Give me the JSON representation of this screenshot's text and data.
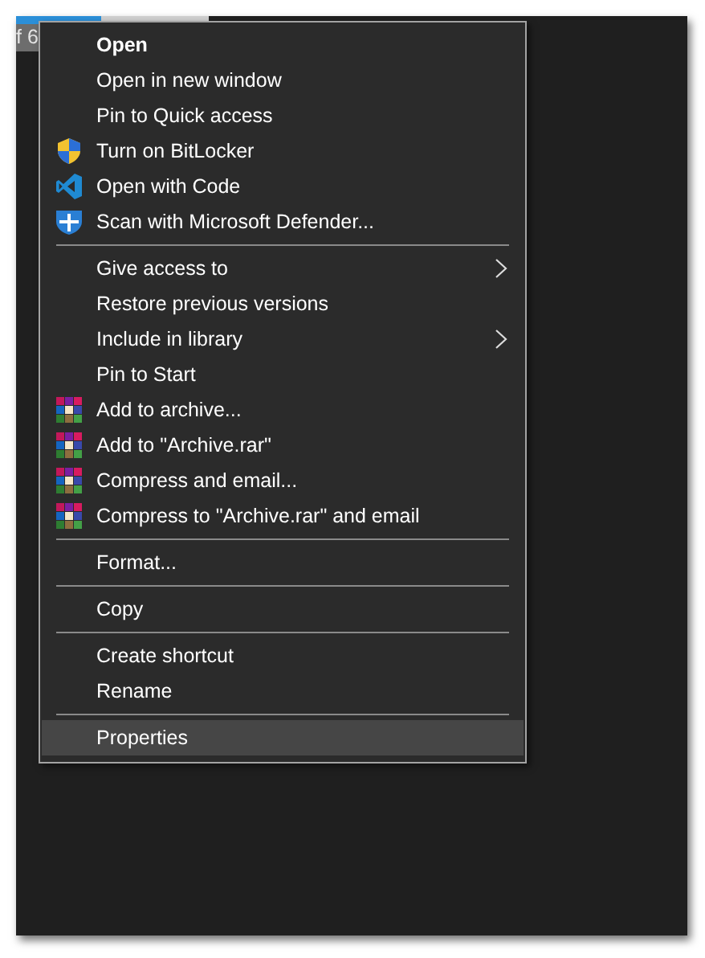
{
  "background": {
    "tab_text": "f 6"
  },
  "menu": {
    "groups": [
      [
        {
          "label": "Open",
          "kind": "plain",
          "default": true,
          "submenu": false,
          "selected": false
        },
        {
          "label": "Open in new window",
          "kind": "plain",
          "default": false,
          "submenu": false,
          "selected": false
        },
        {
          "label": "Pin to Quick access",
          "kind": "plain",
          "default": false,
          "submenu": false,
          "selected": false
        },
        {
          "label": "Turn on BitLocker",
          "kind": "uac-shield",
          "default": false,
          "submenu": false,
          "selected": false
        },
        {
          "label": "Open with Code",
          "kind": "code",
          "default": false,
          "submenu": false,
          "selected": false
        },
        {
          "label": "Scan with Microsoft Defender...",
          "kind": "defender",
          "default": false,
          "submenu": false,
          "selected": false
        }
      ],
      [
        {
          "label": "Give access to",
          "kind": "plain",
          "default": false,
          "submenu": true,
          "selected": false
        },
        {
          "label": "Restore previous versions",
          "kind": "plain",
          "default": false,
          "submenu": false,
          "selected": false
        },
        {
          "label": "Include in library",
          "kind": "plain",
          "default": false,
          "submenu": true,
          "selected": false
        },
        {
          "label": "Pin to Start",
          "kind": "plain",
          "default": false,
          "submenu": false,
          "selected": false
        },
        {
          "label": "Add to archive...",
          "kind": "archive",
          "default": false,
          "submenu": false,
          "selected": false
        },
        {
          "label": "Add to \"Archive.rar\"",
          "kind": "archive",
          "default": false,
          "submenu": false,
          "selected": false
        },
        {
          "label": "Compress and email...",
          "kind": "archive",
          "default": false,
          "submenu": false,
          "selected": false
        },
        {
          "label": "Compress to \"Archive.rar\" and email",
          "kind": "archive",
          "default": false,
          "submenu": false,
          "selected": false
        }
      ],
      [
        {
          "label": "Format...",
          "kind": "plain",
          "default": false,
          "submenu": false,
          "selected": false
        }
      ],
      [
        {
          "label": "Copy",
          "kind": "plain",
          "default": false,
          "submenu": false,
          "selected": false
        }
      ],
      [
        {
          "label": "Create shortcut",
          "kind": "plain",
          "default": false,
          "submenu": false,
          "selected": false
        },
        {
          "label": "Rename",
          "kind": "plain",
          "default": false,
          "submenu": false,
          "selected": false
        }
      ],
      [
        {
          "label": "Properties",
          "kind": "plain",
          "default": false,
          "submenu": false,
          "selected": true
        }
      ]
    ]
  }
}
